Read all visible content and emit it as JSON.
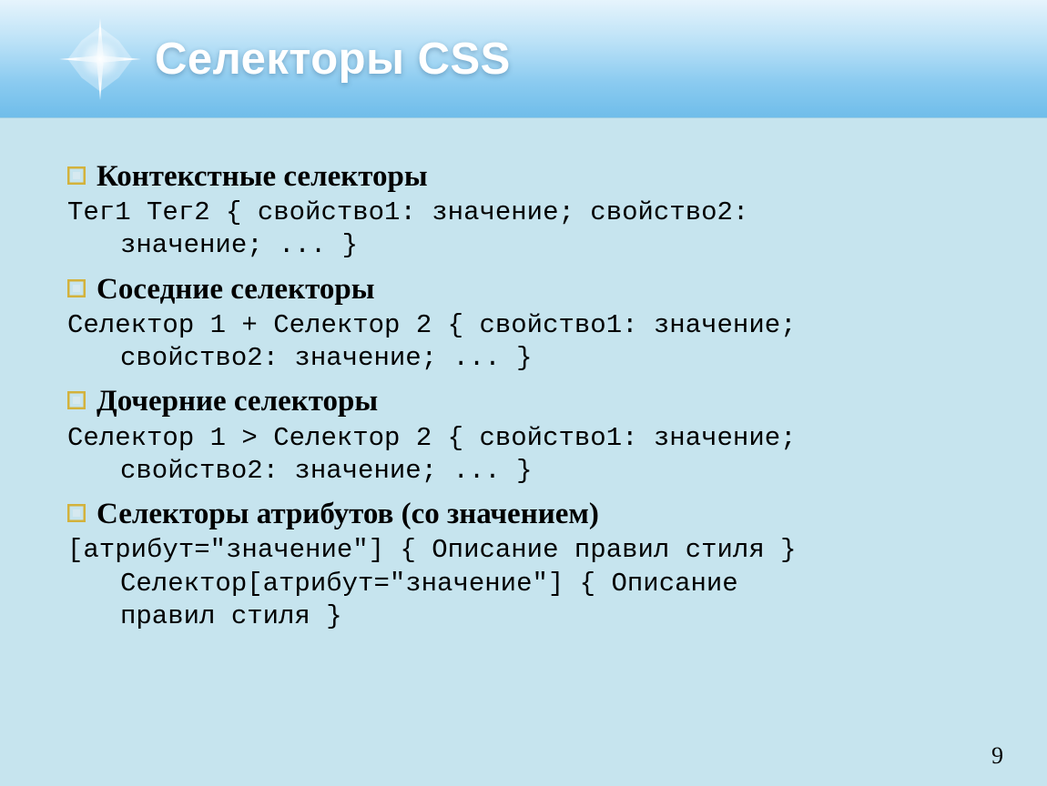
{
  "title": "Селекторы CSS",
  "page_number": "9",
  "sections": [
    {
      "heading": "Контекстные селекторы",
      "code_line1": "Тег1 Тег2 { свойство1: значение; свойство2:",
      "code_line2": "значение; ... }"
    },
    {
      "heading": "Соседние селекторы",
      "code_line1": "Селектор 1 + Селектор 2 { свойство1: значение;",
      "code_line2": "свойство2: значение; ... }"
    },
    {
      "heading": "Дочерние селекторы",
      "code_line1": "Селектор 1 > Селектор 2 { свойство1: значение;",
      "code_line2": "свойство2: значение; ... }"
    },
    {
      "heading": "Селекторы атрибутов (со значением)",
      "code_line1": "[атрибут=\"значение\"] { Описание правил стиля }",
      "code_line2": "Селектор[атрибут=\"значение\"] { Описание",
      "code_line3": "правил стиля }"
    }
  ]
}
